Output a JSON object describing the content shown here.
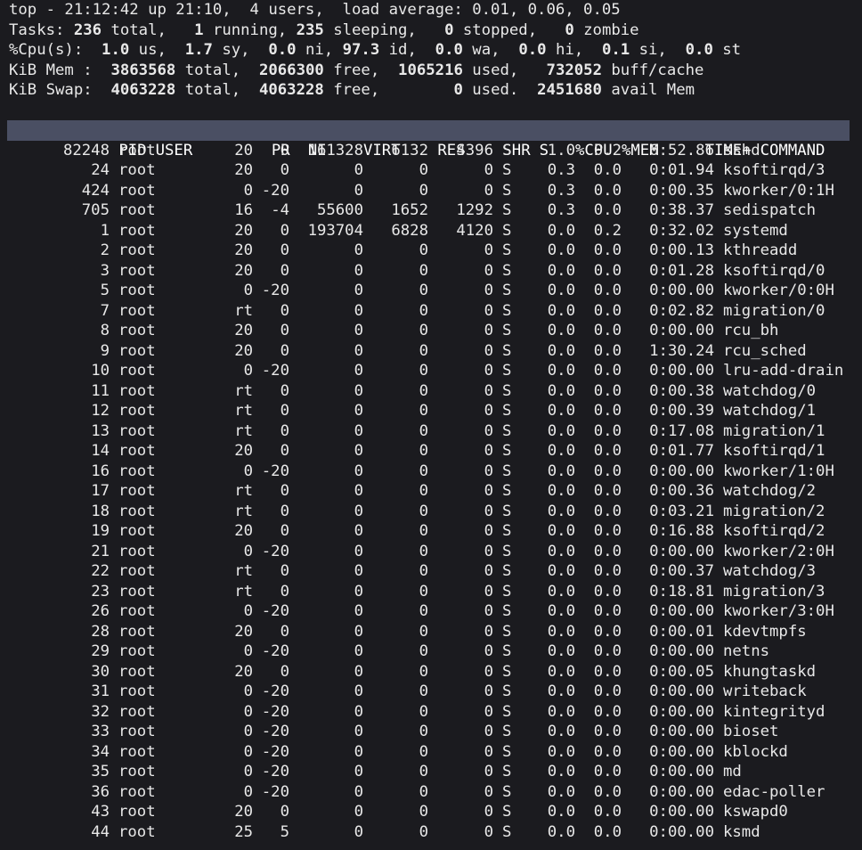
{
  "summary": {
    "line1": "top - 21:12:42 up 21:10,  4 users,  load average: 0.01, 0.06, 0.05",
    "tasks": {
      "label": "Tasks:",
      "total": "236",
      "total_label": "total,",
      "running": "1",
      "running_label": "running,",
      "sleeping": "235",
      "sleeping_label": "sleeping,",
      "stopped": "0",
      "stopped_label": "stopped,",
      "zombie": "0",
      "zombie_label": "zombie"
    },
    "cpu": {
      "label": "%Cpu(s):",
      "us": "1.0",
      "us_label": "us,",
      "sy": "1.7",
      "sy_label": "sy,",
      "ni": "0.0",
      "ni_label": "ni,",
      "id": "97.3",
      "id_label": "id,",
      "wa": "0.0",
      "wa_label": "wa,",
      "hi": "0.0",
      "hi_label": "hi,",
      "si": "0.1",
      "si_label": "si,",
      "st": "0.0",
      "st_label": "st"
    },
    "mem": {
      "label": "KiB Mem :",
      "total": "3863568",
      "total_label": "total,",
      "free": "2066300",
      "free_label": "free,",
      "used": "1065216",
      "used_label": "used,",
      "buff": "732052",
      "buff_label": "buff/cache"
    },
    "swap": {
      "label": "KiB Swap:",
      "total": "4063228",
      "total_label": "total,",
      "free": "4063228",
      "free_label": "free,",
      "used": "0",
      "used_label": "used.",
      "avail": "2451680",
      "avail_label": "avail Mem"
    }
  },
  "columns": [
    "PID",
    "USER",
    "PR",
    "NI",
    "VIRT",
    "RES",
    "SHR",
    "S",
    "%CPU",
    "%MEM",
    "TIME+",
    "COMMAND"
  ],
  "processes": [
    [
      "82248",
      "root",
      "20",
      "0",
      "161328",
      "6132",
      "4396",
      "S",
      "1.0",
      "0.2",
      "6:52.86",
      "sshd"
    ],
    [
      "24",
      "root",
      "20",
      "0",
      "0",
      "0",
      "0",
      "S",
      "0.3",
      "0.0",
      "0:01.94",
      "ksoftirqd/3"
    ],
    [
      "424",
      "root",
      "0",
      "-20",
      "0",
      "0",
      "0",
      "S",
      "0.3",
      "0.0",
      "0:00.35",
      "kworker/0:1H"
    ],
    [
      "705",
      "root",
      "16",
      "-4",
      "55600",
      "1652",
      "1292",
      "S",
      "0.3",
      "0.0",
      "0:38.37",
      "sedispatch"
    ],
    [
      "1",
      "root",
      "20",
      "0",
      "193704",
      "6828",
      "4120",
      "S",
      "0.0",
      "0.2",
      "0:32.02",
      "systemd"
    ],
    [
      "2",
      "root",
      "20",
      "0",
      "0",
      "0",
      "0",
      "S",
      "0.0",
      "0.0",
      "0:00.13",
      "kthreadd"
    ],
    [
      "3",
      "root",
      "20",
      "0",
      "0",
      "0",
      "0",
      "S",
      "0.0",
      "0.0",
      "0:01.28",
      "ksoftirqd/0"
    ],
    [
      "5",
      "root",
      "0",
      "-20",
      "0",
      "0",
      "0",
      "S",
      "0.0",
      "0.0",
      "0:00.00",
      "kworker/0:0H"
    ],
    [
      "7",
      "root",
      "rt",
      "0",
      "0",
      "0",
      "0",
      "S",
      "0.0",
      "0.0",
      "0:02.82",
      "migration/0"
    ],
    [
      "8",
      "root",
      "20",
      "0",
      "0",
      "0",
      "0",
      "S",
      "0.0",
      "0.0",
      "0:00.00",
      "rcu_bh"
    ],
    [
      "9",
      "root",
      "20",
      "0",
      "0",
      "0",
      "0",
      "S",
      "0.0",
      "0.0",
      "1:30.24",
      "rcu_sched"
    ],
    [
      "10",
      "root",
      "0",
      "-20",
      "0",
      "0",
      "0",
      "S",
      "0.0",
      "0.0",
      "0:00.00",
      "lru-add-drain"
    ],
    [
      "11",
      "root",
      "rt",
      "0",
      "0",
      "0",
      "0",
      "S",
      "0.0",
      "0.0",
      "0:00.38",
      "watchdog/0"
    ],
    [
      "12",
      "root",
      "rt",
      "0",
      "0",
      "0",
      "0",
      "S",
      "0.0",
      "0.0",
      "0:00.39",
      "watchdog/1"
    ],
    [
      "13",
      "root",
      "rt",
      "0",
      "0",
      "0",
      "0",
      "S",
      "0.0",
      "0.0",
      "0:17.08",
      "migration/1"
    ],
    [
      "14",
      "root",
      "20",
      "0",
      "0",
      "0",
      "0",
      "S",
      "0.0",
      "0.0",
      "0:01.77",
      "ksoftirqd/1"
    ],
    [
      "16",
      "root",
      "0",
      "-20",
      "0",
      "0",
      "0",
      "S",
      "0.0",
      "0.0",
      "0:00.00",
      "kworker/1:0H"
    ],
    [
      "17",
      "root",
      "rt",
      "0",
      "0",
      "0",
      "0",
      "S",
      "0.0",
      "0.0",
      "0:00.36",
      "watchdog/2"
    ],
    [
      "18",
      "root",
      "rt",
      "0",
      "0",
      "0",
      "0",
      "S",
      "0.0",
      "0.0",
      "0:03.21",
      "migration/2"
    ],
    [
      "19",
      "root",
      "20",
      "0",
      "0",
      "0",
      "0",
      "S",
      "0.0",
      "0.0",
      "0:16.88",
      "ksoftirqd/2"
    ],
    [
      "21",
      "root",
      "0",
      "-20",
      "0",
      "0",
      "0",
      "S",
      "0.0",
      "0.0",
      "0:00.00",
      "kworker/2:0H"
    ],
    [
      "22",
      "root",
      "rt",
      "0",
      "0",
      "0",
      "0",
      "S",
      "0.0",
      "0.0",
      "0:00.37",
      "watchdog/3"
    ],
    [
      "23",
      "root",
      "rt",
      "0",
      "0",
      "0",
      "0",
      "S",
      "0.0",
      "0.0",
      "0:18.81",
      "migration/3"
    ],
    [
      "26",
      "root",
      "0",
      "-20",
      "0",
      "0",
      "0",
      "S",
      "0.0",
      "0.0",
      "0:00.00",
      "kworker/3:0H"
    ],
    [
      "28",
      "root",
      "20",
      "0",
      "0",
      "0",
      "0",
      "S",
      "0.0",
      "0.0",
      "0:00.01",
      "kdevtmpfs"
    ],
    [
      "29",
      "root",
      "0",
      "-20",
      "0",
      "0",
      "0",
      "S",
      "0.0",
      "0.0",
      "0:00.00",
      "netns"
    ],
    [
      "30",
      "root",
      "20",
      "0",
      "0",
      "0",
      "0",
      "S",
      "0.0",
      "0.0",
      "0:00.05",
      "khungtaskd"
    ],
    [
      "31",
      "root",
      "0",
      "-20",
      "0",
      "0",
      "0",
      "S",
      "0.0",
      "0.0",
      "0:00.00",
      "writeback"
    ],
    [
      "32",
      "root",
      "0",
      "-20",
      "0",
      "0",
      "0",
      "S",
      "0.0",
      "0.0",
      "0:00.00",
      "kintegrityd"
    ],
    [
      "33",
      "root",
      "0",
      "-20",
      "0",
      "0",
      "0",
      "S",
      "0.0",
      "0.0",
      "0:00.00",
      "bioset"
    ],
    [
      "34",
      "root",
      "0",
      "-20",
      "0",
      "0",
      "0",
      "S",
      "0.0",
      "0.0",
      "0:00.00",
      "kblockd"
    ],
    [
      "35",
      "root",
      "0",
      "-20",
      "0",
      "0",
      "0",
      "S",
      "0.0",
      "0.0",
      "0:00.00",
      "md"
    ],
    [
      "36",
      "root",
      "0",
      "-20",
      "0",
      "0",
      "0",
      "S",
      "0.0",
      "0.0",
      "0:00.00",
      "edac-poller"
    ],
    [
      "43",
      "root",
      "20",
      "0",
      "0",
      "0",
      "0",
      "S",
      "0.0",
      "0.0",
      "0:00.00",
      "kswapd0"
    ],
    [
      "44",
      "root",
      "25",
      "5",
      "0",
      "0",
      "0",
      "S",
      "0.0",
      "0.0",
      "0:00.00",
      "ksmd"
    ]
  ],
  "colors": {
    "background": "#1b1b1f",
    "text": "#e8e8e8",
    "header_bar": "#4a4f63"
  }
}
